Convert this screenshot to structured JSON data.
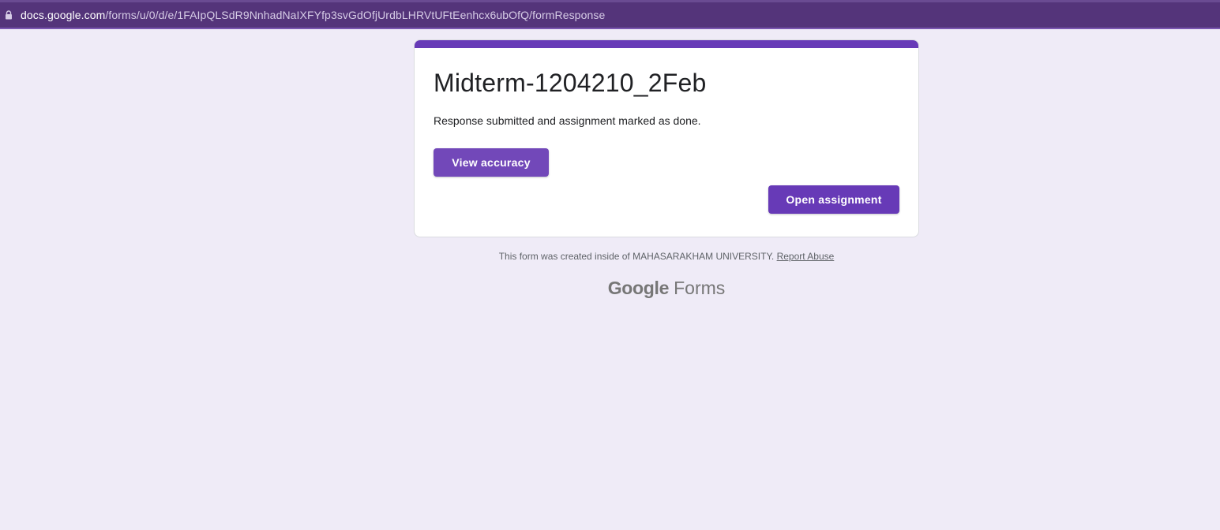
{
  "browser": {
    "url_domain": "docs.google.com",
    "url_path": "/forms/u/0/d/e/1FAIpQLSdR9NnhadNaIXFYfp3svGdOfjUrdbLHRVtUFtEenhcx6ubOfQ/formResponse"
  },
  "form": {
    "title": "Midterm-1204210_2Feb",
    "confirmation": "Response submitted and assignment marked as done.",
    "view_accuracy_label": "View accuracy",
    "open_assignment_label": "Open assignment"
  },
  "footer": {
    "note": "This form was created inside of MAHASARAKHAM UNIVERSITY.",
    "report_label": "Report Abuse",
    "brand_google": "Google",
    "brand_forms": "Forms"
  },
  "colors": {
    "accent": "#673ab7",
    "page_background": "#efebf7",
    "address_bar": "#54347a"
  },
  "icons": {
    "address_bar": "lock-icon"
  }
}
